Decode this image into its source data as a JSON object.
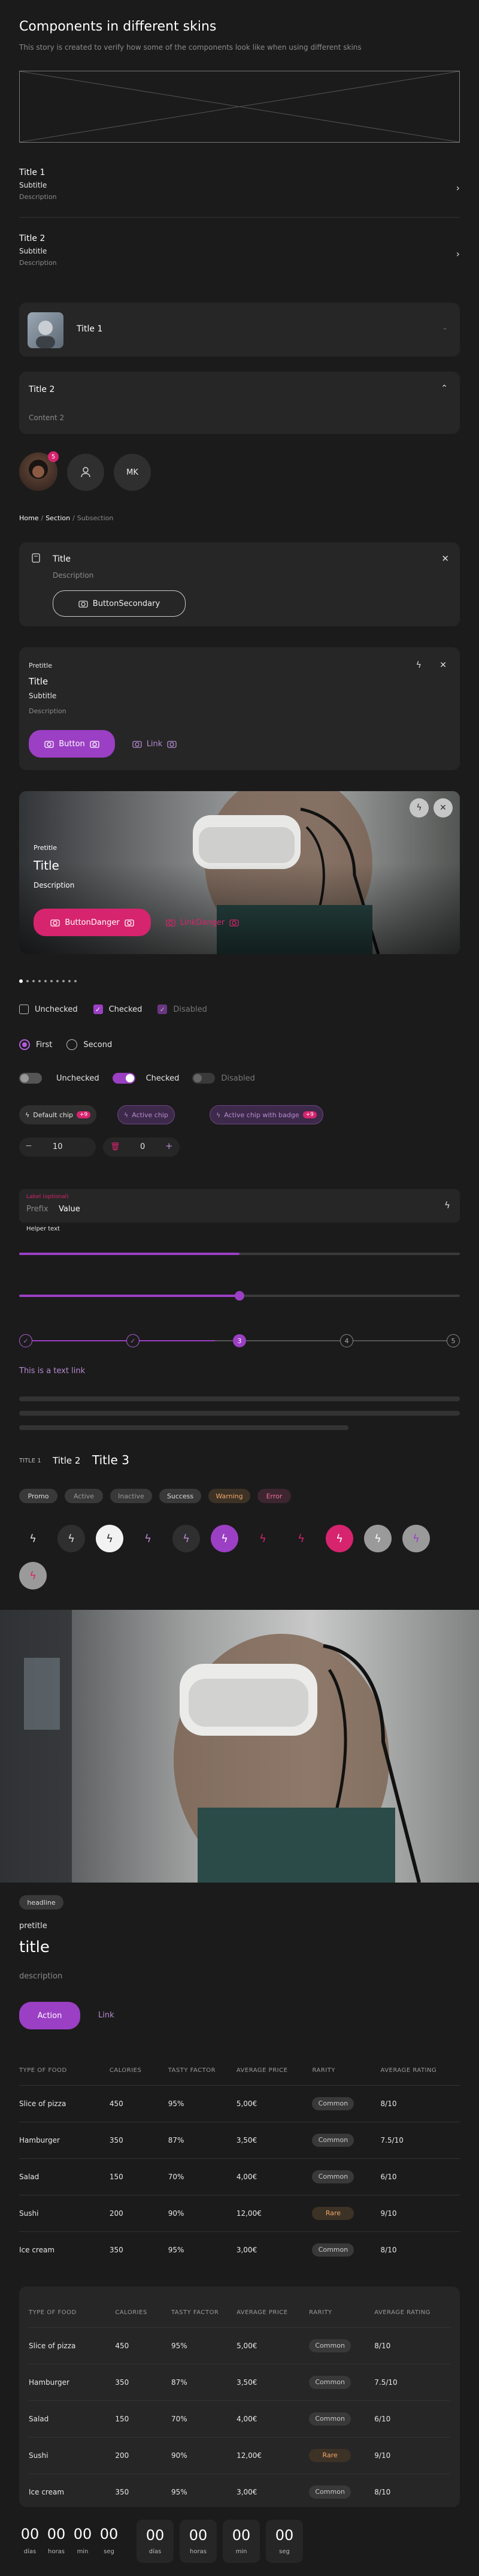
{
  "header": {
    "title": "Components in different skins",
    "subtitle": "This story is created to verify how some of the components look like when using different skins"
  },
  "list1": {
    "title": "Title 1",
    "subtitle": "Subtitle",
    "description": "Description"
  },
  "list2": {
    "title": "Title 2",
    "subtitle": "Subtitle",
    "description": "Description"
  },
  "accordion1": {
    "title": "Title 1"
  },
  "accordion2": {
    "title": "Title 2",
    "content": "Content 2"
  },
  "avatars": {
    "badge": "5",
    "initials": "MK"
  },
  "breadcrumb": {
    "home": "Home",
    "sep1": "/",
    "section": "Section",
    "sep2": "/",
    "current": "Subsection"
  },
  "callout": {
    "title": "Title",
    "description": "Description",
    "button": "ButtonSecondary"
  },
  "card1": {
    "pretitle": "Pretitle",
    "title": "Title",
    "subtitle": "Subtitle",
    "description": "Description",
    "button": "Button",
    "link": "Link"
  },
  "card2": {
    "pretitle": "Pretitle",
    "title": "Title",
    "description": "Description",
    "button": "ButtonDanger",
    "link": "LinkDanger"
  },
  "checkboxes": {
    "unchecked": "Unchecked",
    "checked": "Checked",
    "disabled": "Disabled"
  },
  "radios": {
    "first": "First",
    "second": "Second"
  },
  "switches": {
    "unchecked": "Unchecked",
    "checked": "Checked",
    "disabled": "Disabled"
  },
  "chips": {
    "default": "Default chip",
    "default_count": "+9",
    "active": "Active chip",
    "badge": "Active chip with badge",
    "badge_count": "+9"
  },
  "steppers": {
    "value1": "10",
    "value2": "0"
  },
  "input": {
    "label": "Label (optional)",
    "prefix": "Prefix",
    "value": "Value",
    "helper": "Helper text"
  },
  "progress": {
    "value": 0.5
  },
  "slider": {
    "value": 0.5
  },
  "steps": {
    "current": "3",
    "step4": "4",
    "step5": "5"
  },
  "textlink": "This is a text link",
  "typography": {
    "overline": "TITLE 1",
    "title2": "Title 2",
    "title3": "Title 3"
  },
  "tags": [
    "Promo",
    "Active",
    "Inactive",
    "Success",
    "Warning",
    "Error"
  ],
  "hero": {
    "headline": "headline",
    "pretitle": "pretitle",
    "title": "title",
    "description": "description",
    "action": "Action",
    "link": "Link"
  },
  "table": {
    "headers": [
      "TYPE OF FOOD",
      "CALORIES",
      "TASTY FACTOR",
      "AVERAGE PRICE",
      "RARITY",
      "AVERAGE RATING"
    ],
    "rows": [
      [
        "Slice of pizza",
        "450",
        "95%",
        "5,00€",
        "Common",
        "8/10"
      ],
      [
        "Hamburger",
        "350",
        "87%",
        "3,50€",
        "Common",
        "7.5/10"
      ],
      [
        "Salad",
        "150",
        "70%",
        "4,00€",
        "Common",
        "6/10"
      ],
      [
        "Sushi",
        "200",
        "90%",
        "12,00€",
        "Rare",
        "9/10"
      ],
      [
        "Ice cream",
        "350",
        "95%",
        "3,00€",
        "Common",
        "8/10"
      ]
    ]
  },
  "countdown": {
    "values": [
      "00",
      "00",
      "00",
      "00"
    ],
    "labels": [
      "días",
      "horas",
      "min",
      "seg"
    ]
  },
  "colors": {
    "accent": "#9b3fc4",
    "danger": "#d6246e",
    "rare": "#f0a86a"
  }
}
